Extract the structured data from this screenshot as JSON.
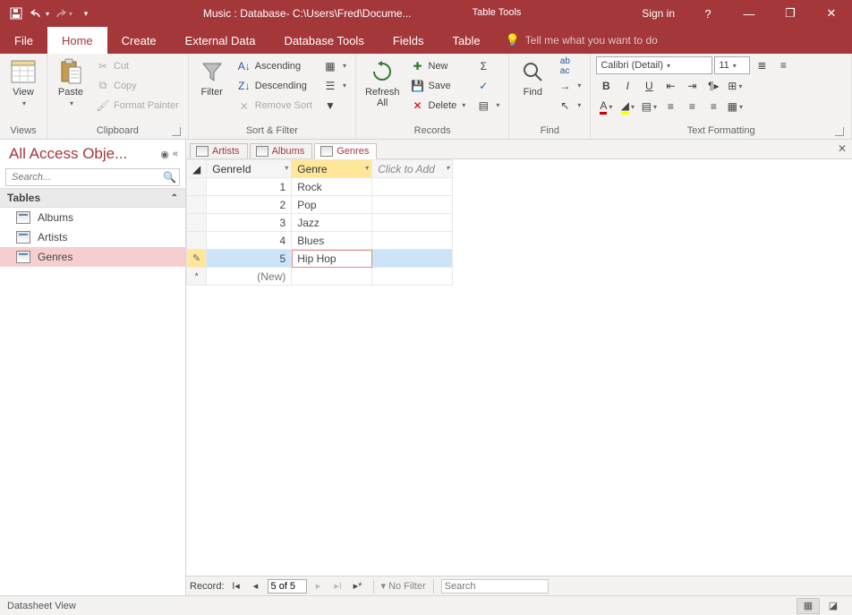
{
  "titlebar": {
    "title": "Music : Database- C:\\Users\\Fred\\Docume...",
    "context_tab": "Table Tools",
    "signin": "Sign in"
  },
  "menu": {
    "tabs": [
      "File",
      "Home",
      "Create",
      "External Data",
      "Database Tools",
      "Fields",
      "Table"
    ],
    "active": "Home",
    "tellme": "Tell me what you want to do"
  },
  "ribbon": {
    "views": {
      "label": "Views",
      "view": "View"
    },
    "clipboard": {
      "label": "Clipboard",
      "paste": "Paste",
      "cut": "Cut",
      "copy": "Copy",
      "format_painter": "Format Painter"
    },
    "sortfilter": {
      "label": "Sort & Filter",
      "filter": "Filter",
      "asc": "Ascending",
      "desc": "Descending",
      "remove": "Remove Sort"
    },
    "records": {
      "label": "Records",
      "refresh": "Refresh\nAll",
      "new": "New",
      "save": "Save",
      "delete": "Delete"
    },
    "find": {
      "label": "Find",
      "find": "Find"
    },
    "text": {
      "label": "Text Formatting",
      "font": "Calibri (Detail)",
      "size": "11"
    }
  },
  "nav": {
    "title": "All Access Obje...",
    "search_placeholder": "Search...",
    "group": "Tables",
    "items": [
      "Albums",
      "Artists",
      "Genres"
    ],
    "selected": "Genres"
  },
  "doctabs": {
    "tabs": [
      "Artists",
      "Albums",
      "Genres"
    ],
    "active": "Genres"
  },
  "grid": {
    "columns": [
      "GenreId",
      "Genre"
    ],
    "active_col": "Genre",
    "click_to_add": "Click to Add",
    "rows": [
      {
        "id": "1",
        "val": "Rock"
      },
      {
        "id": "2",
        "val": "Pop"
      },
      {
        "id": "3",
        "val": "Jazz"
      },
      {
        "id": "4",
        "val": "Blues"
      },
      {
        "id": "5",
        "val": "Hip Hop",
        "editing": true
      }
    ],
    "new_label": "(New)"
  },
  "recnav": {
    "label": "Record:",
    "pos": "5 of 5",
    "nofilter": "No Filter",
    "search": "Search"
  },
  "status": {
    "mode": "Datasheet View"
  }
}
